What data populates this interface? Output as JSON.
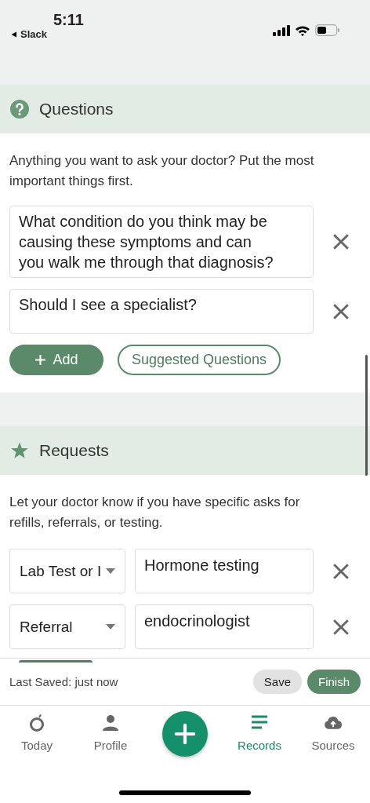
{
  "status_bar": {
    "time": "5:11",
    "back_label": "Slack"
  },
  "questions": {
    "title": "Questions",
    "description": "Anything you want to ask your doctor? Put the most important things first.",
    "items": [
      {
        "value": "What condition do you think may be causing these symptoms and can you walk me through that diagnosis?"
      },
      {
        "value": "Should I see a specialist?"
      }
    ],
    "add_label": "Add",
    "suggested_label": "Suggested Questions"
  },
  "requests": {
    "title": "Requests",
    "description": "Let your doctor know if you have specific asks for refills, referrals, or testing.",
    "items": [
      {
        "type": "Lab Test or I",
        "value": "Hormone testing"
      },
      {
        "type": "Referral",
        "value": "endocrinologist"
      }
    ]
  },
  "save_bar": {
    "status": "Last Saved: just now",
    "save_label": "Save",
    "finish_label": "Finish"
  },
  "tab_bar": [
    {
      "kind": "today",
      "label": "Today",
      "selected": false
    },
    {
      "kind": "profile",
      "label": "Profile",
      "selected": false
    },
    {
      "kind": "fab"
    },
    {
      "kind": "records",
      "label": "Records",
      "selected": true
    },
    {
      "kind": "sources",
      "label": "Sources",
      "selected": false
    }
  ]
}
